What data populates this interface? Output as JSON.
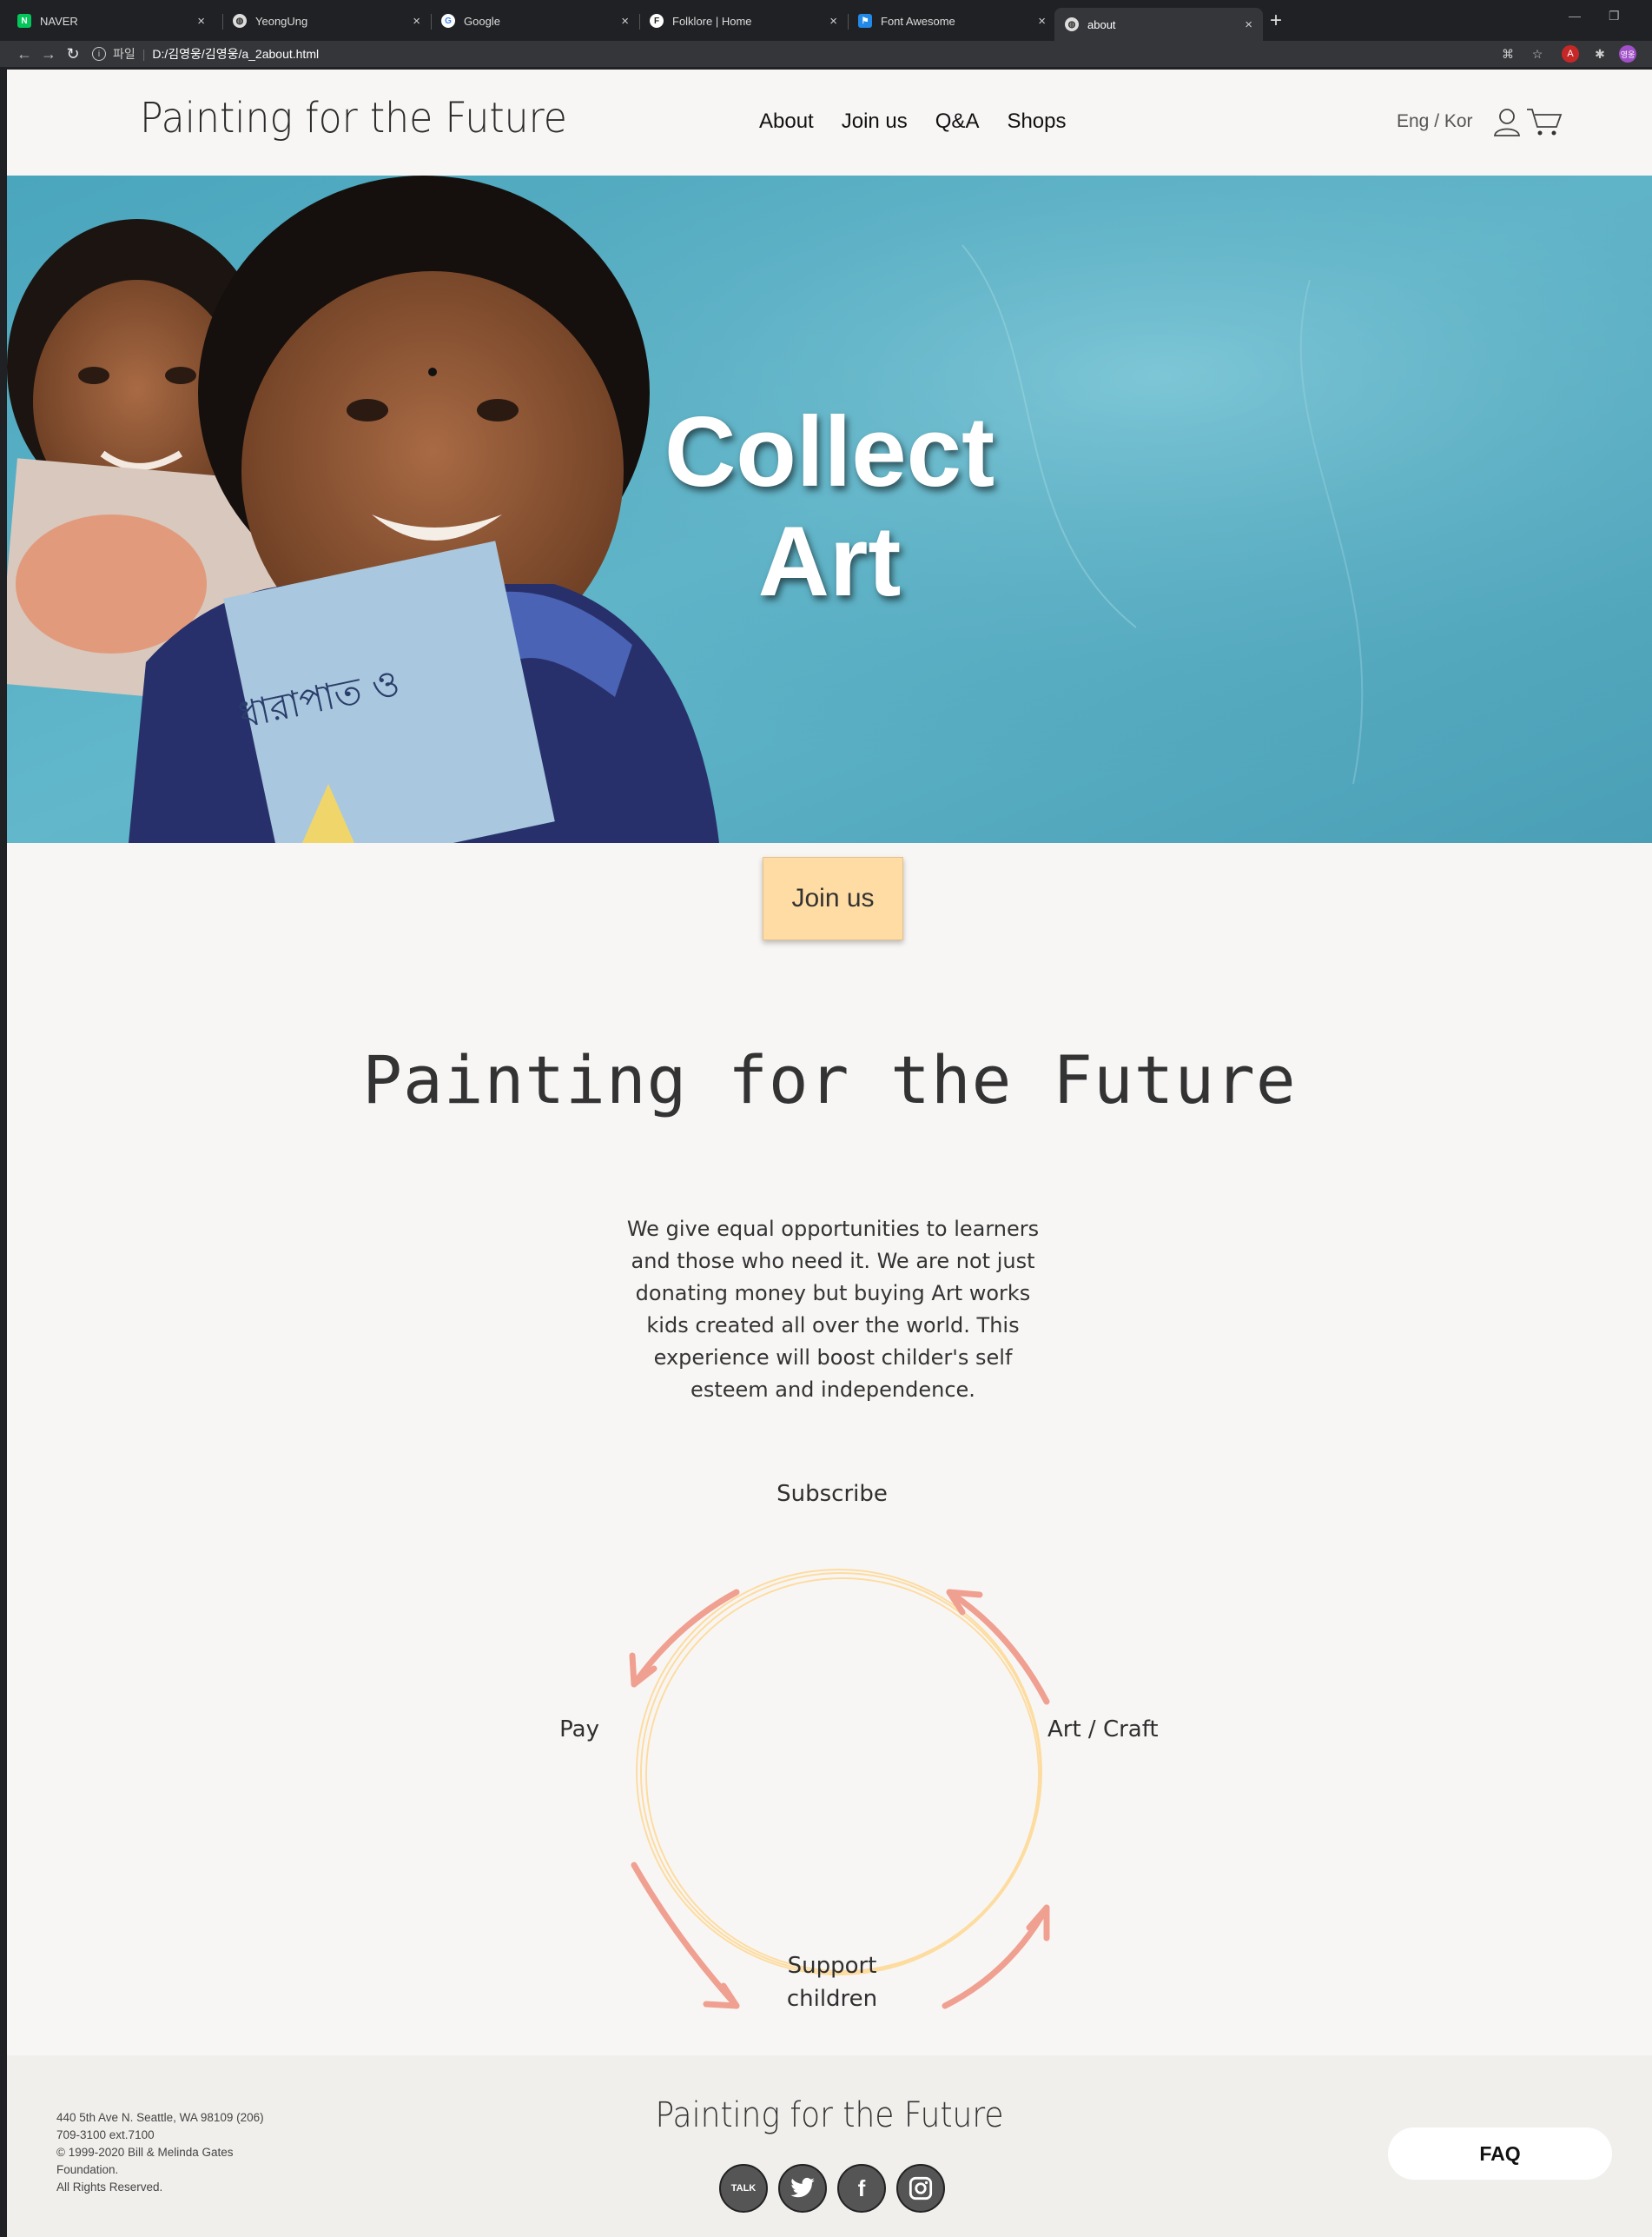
{
  "browser": {
    "tabs": [
      {
        "label": "NAVER",
        "favicon": "naver-icon",
        "color": "#03c75a"
      },
      {
        "label": "YeongUng",
        "favicon": "globe-icon",
        "color": "#888888"
      },
      {
        "label": "Google",
        "favicon": "google-icon",
        "color": "#4285f4"
      },
      {
        "label": "Folklore | Home",
        "favicon": "folklore-icon",
        "color": "#222222"
      },
      {
        "label": "Font Awesome",
        "favicon": "font-awesome-icon",
        "color": "#228ae6"
      },
      {
        "label": "about",
        "favicon": "globe-icon",
        "color": "#888888",
        "active": true
      }
    ],
    "address": {
      "scheme": "파일",
      "url": "D:/김영웅/김영웅/a_2about.html"
    }
  },
  "header": {
    "logo": "Painting for the Future",
    "nav": [
      "About",
      "Join us",
      "Q&A",
      "Shops"
    ],
    "lang": "Eng / Kor"
  },
  "hero": {
    "title_line1": "Collect",
    "title_line2": "Art"
  },
  "join_button": "Join us",
  "section_title": "Painting for the Future",
  "mission": "We give equal opportunities to learners and those who need it. We are not just donating money but buying Art works kids created all over the world. This experience will boost childer's self esteem and independence.",
  "cycle": {
    "top": "Subscribe",
    "right": "Art / Craft",
    "bottom_line1": "Support",
    "bottom_line2": "children",
    "left": "Pay"
  },
  "footer": {
    "address_lines": [
      "440 5th Ave N. Seattle, WA 98109 (206)",
      "709-3100 ext.7100",
      "© 1999-2020 Bill & Melinda Gates",
      "Foundation.",
      "All Rights Reserved."
    ],
    "logo": "Painting for the Future",
    "socials": [
      {
        "name": "kakaotalk-icon",
        "label": "TALK"
      },
      {
        "name": "twitter-icon",
        "label": ""
      },
      {
        "name": "facebook-icon",
        "label": "f"
      },
      {
        "name": "instagram-icon",
        "label": ""
      }
    ],
    "faq": "FAQ"
  },
  "colors": {
    "accent_button": "#ffdca4",
    "arrow": "#f0a090",
    "circle": "#fddca0",
    "page_bg": "#f8f6f5",
    "hero_wall": "#5fb4c8"
  }
}
